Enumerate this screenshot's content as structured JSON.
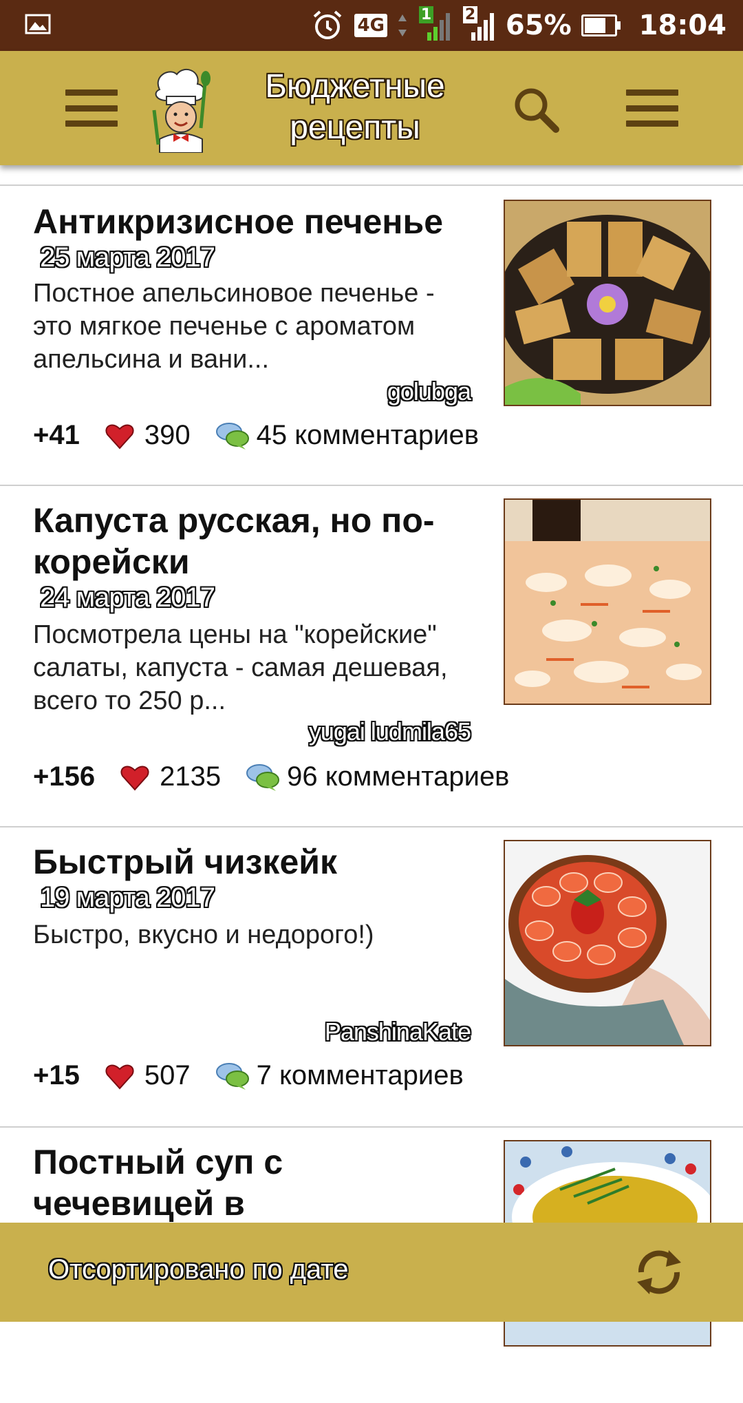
{
  "status_bar": {
    "network": "4G",
    "sim1": "1",
    "sim2": "2",
    "battery": "65%",
    "time": "18:04"
  },
  "app_bar": {
    "title_line1": "Бюджетные",
    "title_line2": "рецепты"
  },
  "recipes": [
    {
      "title": "Антикризисное печенье",
      "date": "25 марта 2017",
      "description": "Постное апельсиновое печенье - это мягкое печенье с ароматом апельсина и вани...",
      "author": "golubga",
      "rating": "+41",
      "likes": "390",
      "comments": "45 комментариев"
    },
    {
      "title": "Капуста русская, но по-корейски",
      "date": "24 марта 2017",
      "description": "Посмотрела цены на \"корейские\" салаты, капуста - самая дешевая, всего то 250 р...",
      "author": "yugai ludmila65",
      "rating": "+156",
      "likes": "2135",
      "comments": "96 комментариев"
    },
    {
      "title": "Быстрый чизкейк",
      "date": "19 марта 2017",
      "description": "Быстро, вкусно и недорого!)",
      "author": "PanshinaKate",
      "rating": "+15",
      "likes": "507",
      "comments": "7 комментариев"
    },
    {
      "title": "Постный суп с чечевицей в"
    }
  ],
  "bottom_bar": {
    "sort_label": "Отсортировано по дате"
  },
  "colors": {
    "status_bar": "#5a2a12",
    "app_bar": "#c9b04d",
    "accent_dark": "#5d4112"
  }
}
